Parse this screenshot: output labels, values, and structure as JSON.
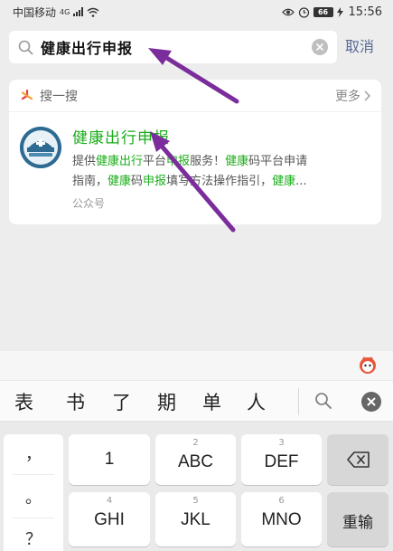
{
  "status_bar": {
    "carrier": "中国移动",
    "network": "4G",
    "battery": "66",
    "time": "15:56"
  },
  "search": {
    "query": "健康出行申报",
    "cancel_label": "取消"
  },
  "card": {
    "header_label": "搜一搜",
    "more_label": "更多",
    "result": {
      "title": "健康出行申报",
      "desc_line1": [
        "提供",
        "健康出行",
        "平台",
        "申报",
        "服务！",
        "健康",
        "码平台申请"
      ],
      "desc_line2": [
        "指南，",
        "健康",
        "码",
        "申报",
        "填写方法操作指引，",
        "健康",
        "..."
      ],
      "account_type": "公众号"
    }
  },
  "keyboard": {
    "candidates": [
      "表",
      "书",
      "了",
      "期",
      "单",
      "人"
    ],
    "punctuation": [
      "，",
      "。",
      "？"
    ],
    "keys": [
      {
        "sub": "",
        "main": "1"
      },
      {
        "sub": "2",
        "main": "ABC"
      },
      {
        "sub": "3",
        "main": "DEF"
      },
      {
        "sub": "4",
        "main": "GHI"
      },
      {
        "sub": "5",
        "main": "JKL"
      },
      {
        "sub": "6",
        "main": "MNO"
      }
    ],
    "reenter_label": "重输"
  },
  "colors": {
    "highlight": "#1aad19",
    "link": "#576b95",
    "arrow": "#7b2d9b"
  }
}
